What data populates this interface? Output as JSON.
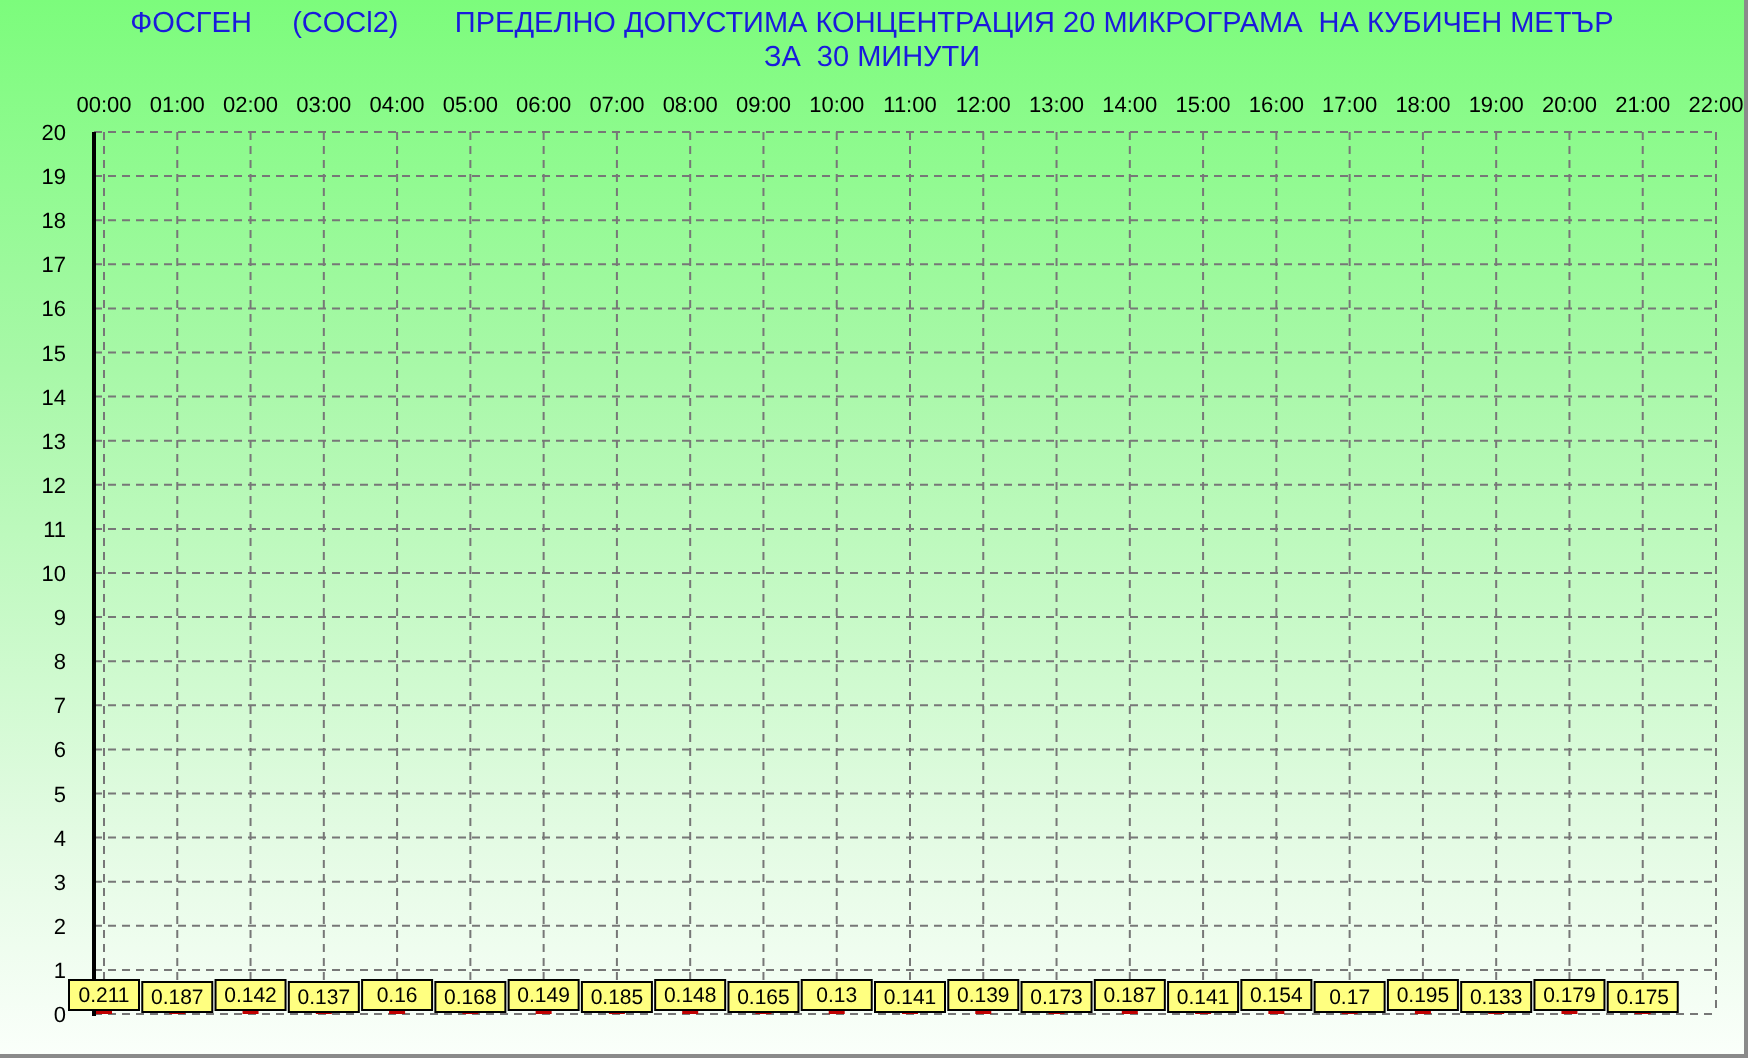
{
  "chart_data": {
    "type": "bar",
    "title": "ФОСГЕН     (COCl2)       ПРЕДЕЛНО ДОПУСТИМА КОНЦЕНТРАЦИЯ 20 МИКРОГРАМА  НА КУБИЧЕН МЕТЪР\nЗА  30 МИНУТИ",
    "x": [
      0,
      1,
      2,
      3,
      4,
      5,
      6,
      7,
      8,
      9,
      10,
      11,
      12,
      13,
      14,
      15,
      16,
      17,
      18,
      19,
      20,
      21
    ],
    "series": [
      {
        "color": "#c00000",
        "values": [
          0.211,
          0.187,
          0.142,
          0.137,
          0.16,
          0.168,
          0.149,
          0.185,
          0.148,
          0.165,
          0.13,
          0.141,
          0.139,
          0.173,
          0.187,
          0.141,
          0.154,
          0.17,
          0.195,
          0.133,
          0.179,
          0.175
        ]
      }
    ],
    "xlim": [
      0,
      22
    ],
    "ylim": [
      0,
      20
    ],
    "xticks": [
      {
        "value": 0,
        "label": "00:00"
      },
      {
        "value": 1,
        "label": "01:00"
      },
      {
        "value": 2,
        "label": "02:00"
      },
      {
        "value": 3,
        "label": "03:00"
      },
      {
        "value": 4,
        "label": "04:00"
      },
      {
        "value": 5,
        "label": "05:00"
      },
      {
        "value": 6,
        "label": "06:00"
      },
      {
        "value": 7,
        "label": "07:00"
      },
      {
        "value": 8,
        "label": "08:00"
      },
      {
        "value": 9,
        "label": "09:00"
      },
      {
        "value": 10,
        "label": "10:00"
      },
      {
        "value": 11,
        "label": "11:00"
      },
      {
        "value": 12,
        "label": "12:00"
      },
      {
        "value": 13,
        "label": "13:00"
      },
      {
        "value": 14,
        "label": "14:00"
      },
      {
        "value": 15,
        "label": "15:00"
      },
      {
        "value": 16,
        "label": "16:00"
      },
      {
        "value": 17,
        "label": "17:00"
      },
      {
        "value": 18,
        "label": "18:00"
      },
      {
        "value": 19,
        "label": "19:00"
      },
      {
        "value": 20,
        "label": "20:00"
      },
      {
        "value": 21,
        "label": "21:00"
      },
      {
        "value": 22,
        "label": "22:00"
      }
    ],
    "yticks": [
      0,
      1,
      2,
      3,
      4,
      5,
      6,
      7,
      8,
      9,
      10,
      11,
      12,
      13,
      14,
      15,
      16,
      17,
      18,
      19,
      20
    ],
    "data_labels": true,
    "grid": true
  }
}
